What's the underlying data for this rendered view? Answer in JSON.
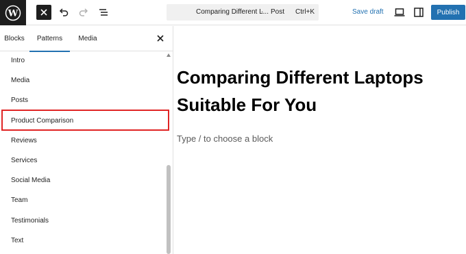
{
  "header": {
    "command_bar": {
      "title": "Comparing Different L...",
      "separator": "·",
      "post_type": "Post",
      "shortcut": "Ctrl+K"
    },
    "save_draft_label": "Save draft",
    "publish_label": "Publish"
  },
  "sidebar": {
    "tabs": [
      {
        "label": "Blocks"
      },
      {
        "label": "Patterns",
        "active": true
      },
      {
        "label": "Media"
      }
    ],
    "pattern_categories": [
      {
        "label": "Intro"
      },
      {
        "label": "Media"
      },
      {
        "label": "Posts"
      },
      {
        "label": "Product Comparison",
        "highlighted": true
      },
      {
        "label": "Reviews"
      },
      {
        "label": "Services"
      },
      {
        "label": "Social Media"
      },
      {
        "label": "Team"
      },
      {
        "label": "Testimonials"
      },
      {
        "label": "Text"
      }
    ]
  },
  "editor": {
    "post_title": "Comparing Different Laptops Suitable For You",
    "block_placeholder": "Type / to choose a block"
  },
  "colors": {
    "accent": "#2271b1",
    "highlight": "#e02424",
    "logo_background": "#1e1e1e"
  },
  "icons": [
    "wordpress-logo-icon",
    "close-icon",
    "undo-icon",
    "redo-icon",
    "document-overview-icon",
    "desktop-view-icon",
    "settings-sidebar-icon"
  ]
}
